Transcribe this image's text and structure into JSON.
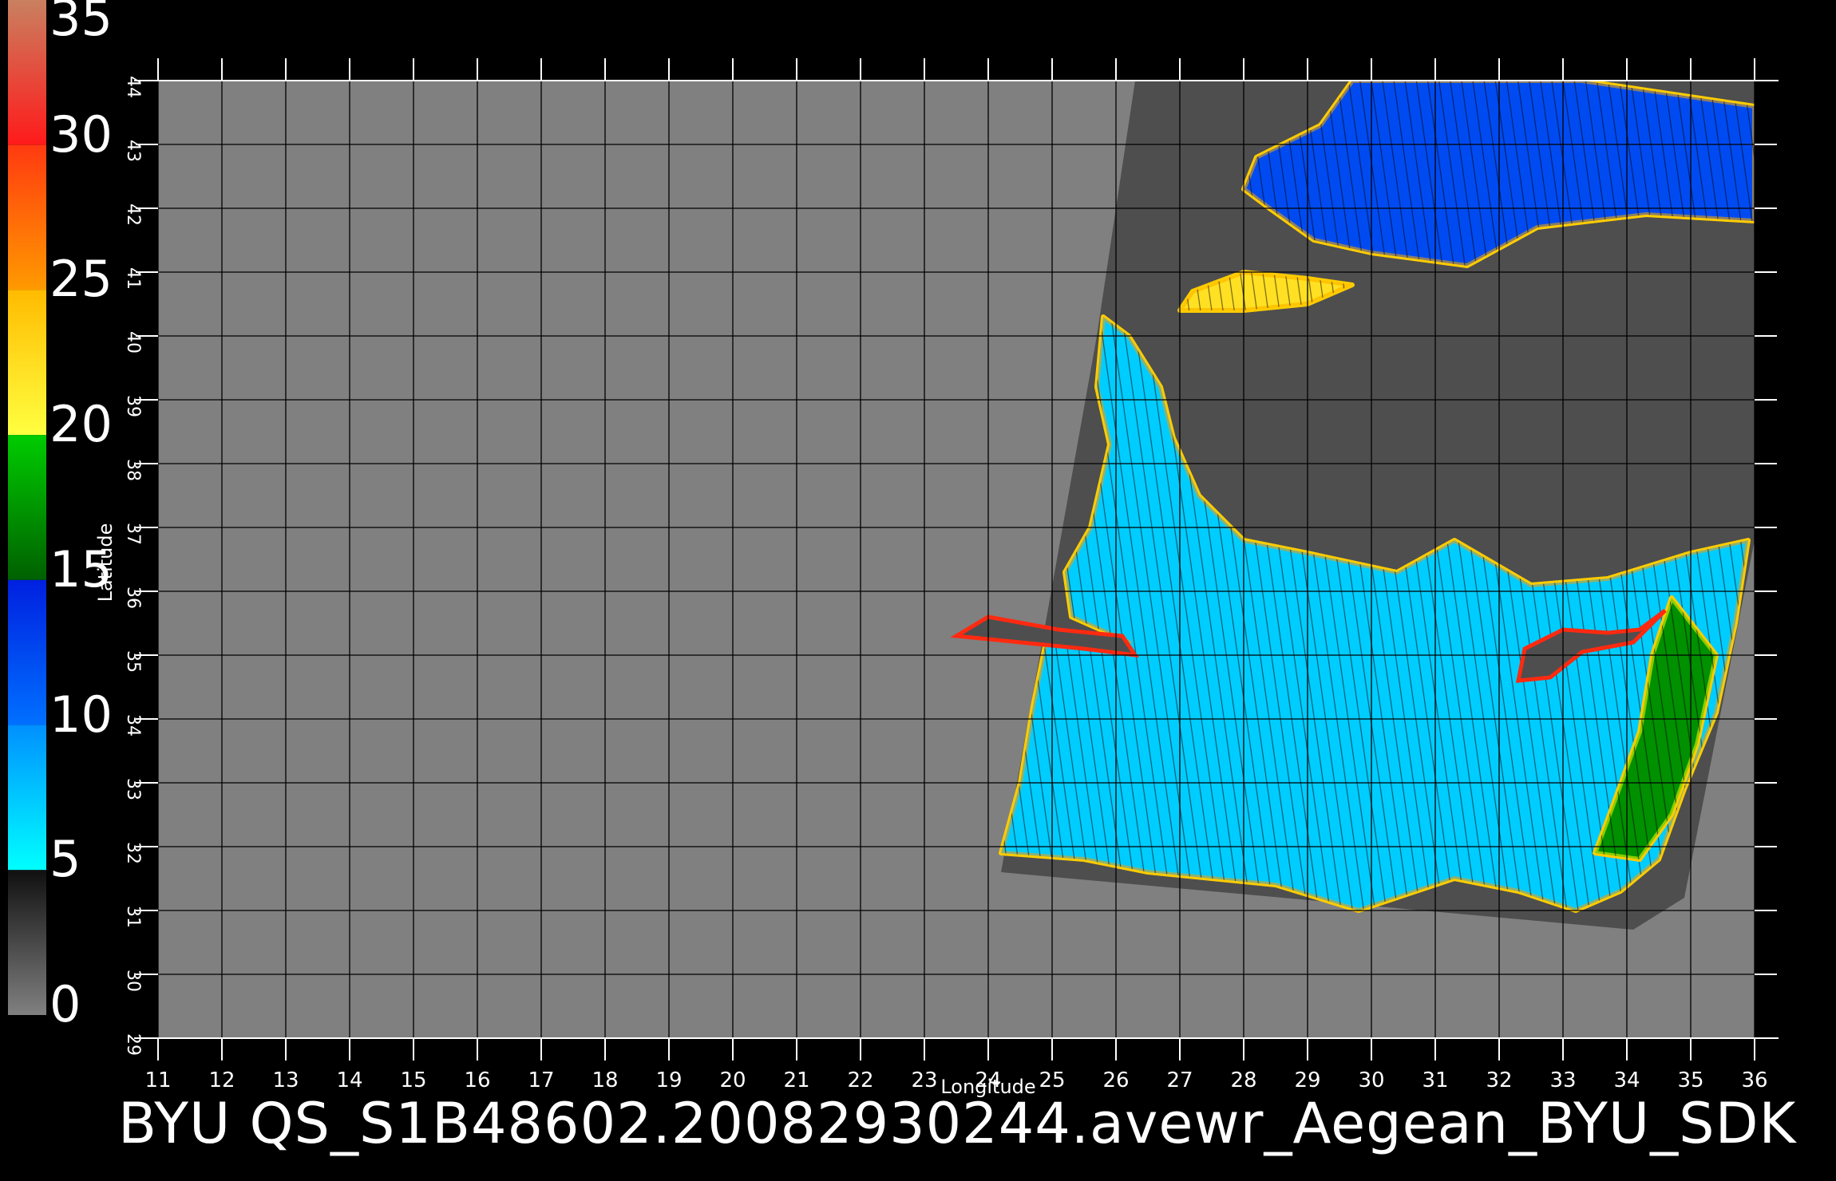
{
  "title": "BYU  QS_S1B48602.20082930244.avewr_Aegean_BYU_SDK",
  "xlabel": "Longitude",
  "ylabel": "Latitude",
  "x_ticks": [
    "11",
    "12",
    "13",
    "14",
    "15",
    "16",
    "17",
    "18",
    "19",
    "20",
    "21",
    "22",
    "23",
    "24",
    "25",
    "26",
    "27",
    "28",
    "29",
    "30",
    "31",
    "32",
    "33",
    "34",
    "35",
    "36"
  ],
  "y_ticks": [
    "29",
    "30",
    "31",
    "32",
    "33",
    "34",
    "35",
    "36",
    "37",
    "38",
    "39",
    "40",
    "41",
    "42",
    "43",
    "44"
  ],
  "colorbar": {
    "labels": [
      "35",
      "30",
      "25",
      "20",
      "15",
      "10",
      "5",
      "0"
    ],
    "segments": [
      {
        "from": 30,
        "to": 35,
        "colors": [
          "#ff1a1a",
          "#c98060"
        ]
      },
      {
        "from": 25,
        "to": 30,
        "colors": [
          "#ff9a00",
          "#ff3a10"
        ]
      },
      {
        "from": 20,
        "to": 25,
        "colors": [
          "#ffff40",
          "#ffbb00"
        ]
      },
      {
        "from": 15,
        "to": 20,
        "colors": [
          "#006000",
          "#00cc00"
        ]
      },
      {
        "from": 10,
        "to": 15,
        "colors": [
          "#0070ff",
          "#0020e0"
        ]
      },
      {
        "from": 5,
        "to": 10,
        "colors": [
          "#00ffff",
          "#0090ff"
        ]
      },
      {
        "from": 0,
        "to": 5,
        "colors": [
          "#808080",
          "#101010"
        ]
      }
    ]
  },
  "colors": {
    "background": "#000000",
    "land": "#808080",
    "swath": "#4e4e4e",
    "grid": "#000000",
    "axis": "#ffffff"
  },
  "map": {
    "lon_range": [
      11,
      36
    ],
    "lat_range": [
      29,
      44
    ],
    "swath_corners_lonlat": [
      [
        26.3,
        44
      ],
      [
        36,
        44
      ],
      [
        36,
        36.8
      ],
      [
        34.9,
        31.2
      ],
      [
        34.1,
        30.7
      ],
      [
        24.2,
        31.6
      ],
      [
        25.7,
        40.0
      ]
    ],
    "wind_fields": [
      {
        "region": "black-sea",
        "outline_lonlat": [
          [
            29.7,
            44
          ],
          [
            33.3,
            44
          ],
          [
            36,
            43.6
          ],
          [
            36,
            41.8
          ],
          [
            34.3,
            41.9
          ],
          [
            32.6,
            41.7
          ],
          [
            31.5,
            41.1
          ],
          [
            30.0,
            41.3
          ],
          [
            29.1,
            41.5
          ],
          [
            28.4,
            42.0
          ],
          [
            28.0,
            42.3
          ],
          [
            28.2,
            42.8
          ],
          [
            29.2,
            43.3
          ],
          [
            29.7,
            44
          ]
        ],
        "mean_speed": 14
      },
      {
        "region": "marmara",
        "outline_lonlat": [
          [
            27.2,
            40.7
          ],
          [
            28.0,
            41.0
          ],
          [
            29.0,
            40.9
          ],
          [
            29.7,
            40.8
          ],
          [
            29.0,
            40.5
          ],
          [
            28.0,
            40.4
          ],
          [
            27.0,
            40.4
          ],
          [
            27.2,
            40.7
          ]
        ],
        "mean_speed": 20
      },
      {
        "region": "aegean-levantine",
        "outline_lonlat": [
          [
            25.8,
            40.3
          ],
          [
            26.2,
            40.0
          ],
          [
            26.7,
            39.2
          ],
          [
            26.9,
            38.4
          ],
          [
            27.3,
            37.5
          ],
          [
            28.0,
            36.8
          ],
          [
            29.0,
            36.6
          ],
          [
            30.4,
            36.3
          ],
          [
            31.3,
            36.8
          ],
          [
            32.5,
            36.1
          ],
          [
            33.7,
            36.2
          ],
          [
            35.0,
            36.6
          ],
          [
            35.9,
            36.8
          ],
          [
            35.7,
            35.5
          ],
          [
            35.4,
            34.1
          ],
          [
            34.9,
            32.9
          ],
          [
            34.5,
            31.8
          ],
          [
            33.9,
            31.3
          ],
          [
            33.2,
            31.0
          ],
          [
            32.3,
            31.3
          ],
          [
            31.3,
            31.5
          ],
          [
            29.8,
            31.0
          ],
          [
            28.5,
            31.4
          ],
          [
            26.5,
            31.6
          ],
          [
            25.5,
            31.8
          ],
          [
            24.2,
            31.9
          ],
          [
            24.5,
            33.0
          ],
          [
            24.7,
            34.2
          ],
          [
            24.9,
            35.2
          ],
          [
            25.5,
            35.3
          ],
          [
            26.2,
            35.2
          ],
          [
            25.3,
            35.6
          ],
          [
            25.2,
            36.3
          ],
          [
            25.6,
            37.0
          ],
          [
            25.9,
            38.3
          ],
          [
            25.7,
            39.2
          ],
          [
            25.8,
            40.3
          ]
        ],
        "mean_speed": 9
      },
      {
        "region": "levant-coast",
        "outline_lonlat": [
          [
            34.7,
            35.9
          ],
          [
            35.4,
            35.0
          ],
          [
            35.1,
            33.6
          ],
          [
            34.7,
            32.5
          ],
          [
            34.2,
            31.8
          ],
          [
            33.5,
            31.9
          ],
          [
            33.8,
            32.7
          ],
          [
            34.2,
            33.8
          ],
          [
            34.4,
            35.0
          ],
          [
            34.7,
            35.9
          ]
        ],
        "mean_speed": 16
      }
    ],
    "islands_lonlat": [
      [
        [
          32.3,
          34.6
        ],
        [
          32.8,
          34.65
        ],
        [
          33.3,
          35.05
        ],
        [
          34.1,
          35.2
        ],
        [
          34.6,
          35.7
        ],
        [
          34.2,
          35.4
        ],
        [
          33.7,
          35.35
        ],
        [
          33.0,
          35.4
        ],
        [
          32.4,
          35.1
        ],
        [
          32.3,
          34.6
        ]
      ],
      [
        [
          23.5,
          35.3
        ],
        [
          24.5,
          35.2
        ],
        [
          25.5,
          35.1
        ],
        [
          26.3,
          35.0
        ],
        [
          26.1,
          35.3
        ],
        [
          25.1,
          35.4
        ],
        [
          24.0,
          35.6
        ],
        [
          23.5,
          35.3
        ]
      ]
    ]
  }
}
